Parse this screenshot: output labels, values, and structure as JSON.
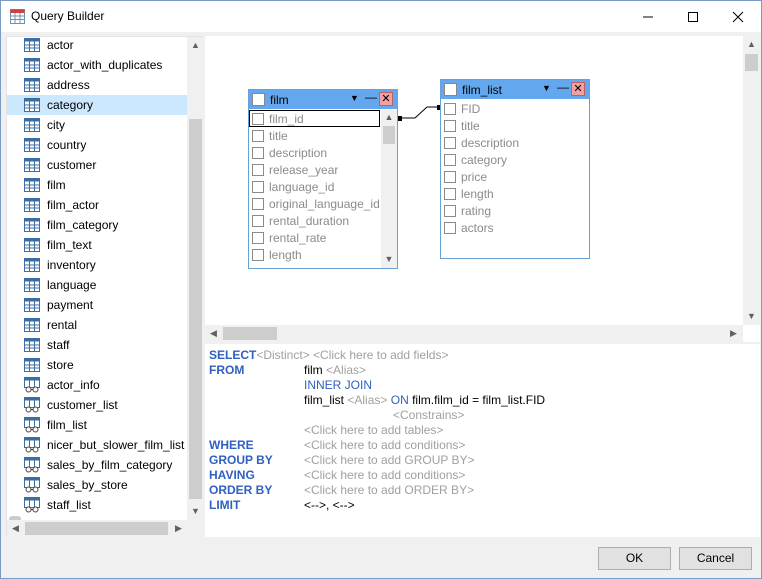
{
  "window": {
    "title": "Query Builder"
  },
  "tables": [
    "actor",
    "actor_with_duplicates",
    "address",
    "category",
    "city",
    "country",
    "customer",
    "film",
    "film_actor",
    "film_category",
    "film_text",
    "inventory",
    "language",
    "payment",
    "rental",
    "staff",
    "store"
  ],
  "views": [
    "actor_info",
    "customer_list",
    "film_list",
    "nicer_but_slower_film_list",
    "sales_by_film_category",
    "sales_by_store",
    "staff_list"
  ],
  "film_table": {
    "name": "film",
    "fields": [
      "film_id",
      "title",
      "description",
      "release_year",
      "language_id",
      "original_language_id",
      "rental_duration",
      "rental_rate",
      "length"
    ]
  },
  "film_list_table": {
    "name": "film_list",
    "fields": [
      "FID",
      "title",
      "description",
      "category",
      "price",
      "length",
      "rating",
      "actors"
    ]
  },
  "sql": {
    "select_kw": "SELECT",
    "distinct": "<Distinct>",
    "add_fields": "<Click here to add fields>",
    "from_kw": "FROM",
    "from_table": "film",
    "alias": "<Alias>",
    "inner_join": "INNER JOIN",
    "join_table": "film_list",
    "on_kw": "ON",
    "on_cond": "film.film_id = film_list.FID",
    "constrains": "<Constrains>",
    "add_tables": "<Click here to add tables>",
    "where_kw": "WHERE",
    "add_conditions": "<Click here to add conditions>",
    "groupby_kw": "GROUP BY",
    "add_groupby": "<Click here to add GROUP BY>",
    "having_kw": "HAVING",
    "add_having": "<Click here to add conditions>",
    "orderby_kw": "ORDER BY",
    "add_orderby": "<Click here to add ORDER BY>",
    "limit_kw": "LIMIT",
    "limit_val": "<-->, <-->"
  },
  "buttons": {
    "ok": "OK",
    "cancel": "Cancel"
  }
}
